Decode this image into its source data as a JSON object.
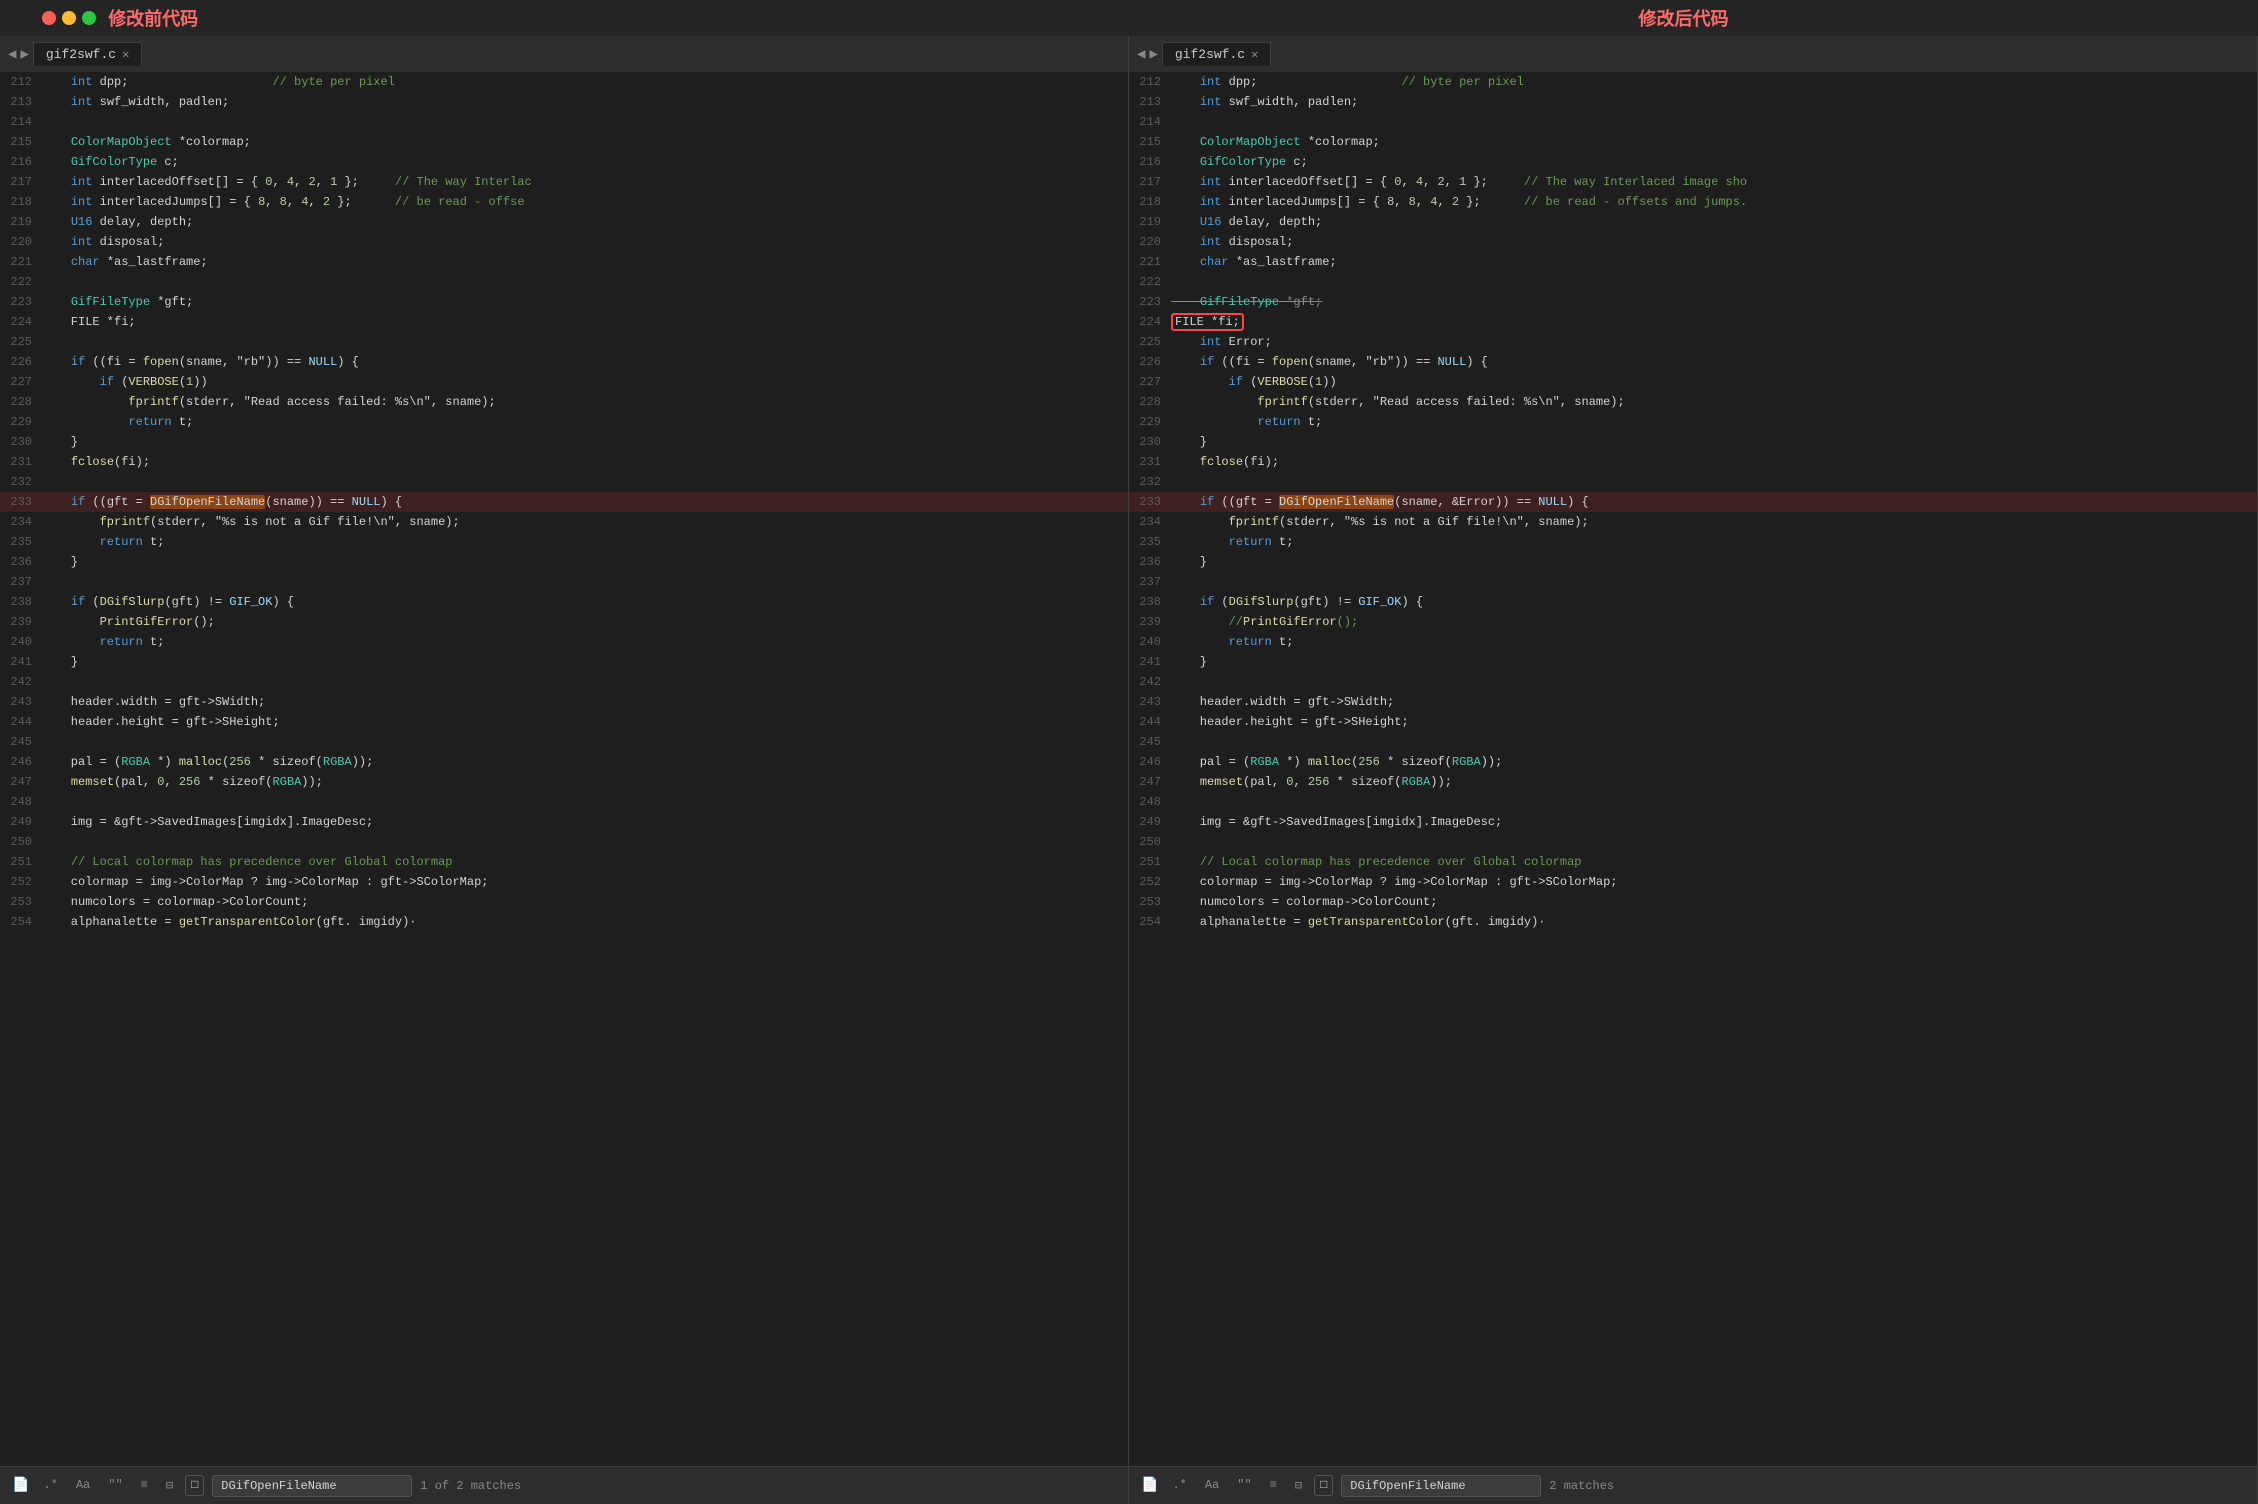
{
  "titles": {
    "left": "修改前代码",
    "right": "修改后代码"
  },
  "tabs": {
    "filename": "gif2swf.c"
  },
  "search": {
    "left": {
      "label": ".*",
      "label2": "Aa",
      "label3": "\"\"",
      "label4": "≡",
      "label5": "⊟",
      "label6": "□",
      "query": "DGifOpenFileName",
      "matches": "1 of 2 matches"
    },
    "right": {
      "label": ".*",
      "label2": "Aa",
      "label3": "\"\"",
      "label4": "≡",
      "label5": "⊟",
      "label6": "□",
      "query": "DGifOpenFileName",
      "matches": "2 matches"
    }
  },
  "left_lines": [
    {
      "num": "212",
      "raw": "    int dpp;                    // byte per pixel"
    },
    {
      "num": "213",
      "raw": "    int swf_width, padlen;"
    },
    {
      "num": "214",
      "raw": ""
    },
    {
      "num": "215",
      "raw": "    ColorMapObject *colormap;"
    },
    {
      "num": "216",
      "raw": "    GifColorType c;"
    },
    {
      "num": "217",
      "raw": "    int interlacedOffset[] = { 0, 4, 2, 1 };     // The way Interlac"
    },
    {
      "num": "218",
      "raw": "    int interlacedJumps[] = { 8, 8, 4, 2 };      // be read - offse"
    },
    {
      "num": "219",
      "raw": "    U16 delay, depth;"
    },
    {
      "num": "220",
      "raw": "    int disposal;"
    },
    {
      "num": "221",
      "raw": "    char *as_lastframe;"
    },
    {
      "num": "222",
      "raw": ""
    },
    {
      "num": "223",
      "raw": "    GifFileType *gft;"
    },
    {
      "num": "224",
      "raw": "    FILE *fi;"
    },
    {
      "num": "225",
      "raw": ""
    },
    {
      "num": "226",
      "raw": "    if ((fi = fopen(sname, \"rb\")) == NULL) {"
    },
    {
      "num": "227",
      "raw": "        if (VERBOSE(1))"
    },
    {
      "num": "228",
      "raw": "            fprintf(stderr, \"Read access failed: %s\\n\", sname);"
    },
    {
      "num": "229",
      "raw": "            return t;"
    },
    {
      "num": "230",
      "raw": "    }"
    },
    {
      "num": "231",
      "raw": "    fclose(fi);"
    },
    {
      "num": "232",
      "raw": ""
    },
    {
      "num": "233",
      "raw": "    if ((gft = DGifOpenFileName(sname)) == NULL) {",
      "highlight": true
    },
    {
      "num": "234",
      "raw": "        fprintf(stderr, \"%s is not a Gif file!\\n\", sname);"
    },
    {
      "num": "235",
      "raw": "        return t;"
    },
    {
      "num": "236",
      "raw": "    }"
    },
    {
      "num": "237",
      "raw": ""
    },
    {
      "num": "238",
      "raw": "    if (DGifSlurp(gft) != GIF_OK) {"
    },
    {
      "num": "239",
      "raw": "        PrintGifError();"
    },
    {
      "num": "240",
      "raw": "        return t;"
    },
    {
      "num": "241",
      "raw": "    }"
    },
    {
      "num": "242",
      "raw": ""
    },
    {
      "num": "243",
      "raw": "    header.width = gft->SWidth;"
    },
    {
      "num": "244",
      "raw": "    header.height = gft->SHeight;"
    },
    {
      "num": "245",
      "raw": ""
    },
    {
      "num": "246",
      "raw": "    pal = (RGBA *) malloc(256 * sizeof(RGBA));"
    },
    {
      "num": "247",
      "raw": "    memset(pal, 0, 256 * sizeof(RGBA));"
    },
    {
      "num": "248",
      "raw": ""
    },
    {
      "num": "249",
      "raw": "    img = &gft->SavedImages[imgidx].ImageDesc;"
    },
    {
      "num": "250",
      "raw": ""
    },
    {
      "num": "251",
      "raw": "    // Local colormap has precedence over Global colormap"
    },
    {
      "num": "252",
      "raw": "    colormap = img->ColorMap ? img->ColorMap : gft->SColorMap;"
    },
    {
      "num": "253",
      "raw": "    numcolors = colormap->ColorCount;"
    },
    {
      "num": "254",
      "raw": "    alphanalette = getTransparentColor(gft. imgidy)·"
    }
  ],
  "right_lines": [
    {
      "num": "212",
      "raw": "    int dpp;                    // byte per pixel"
    },
    {
      "num": "213",
      "raw": "    int swf_width, padlen;"
    },
    {
      "num": "214",
      "raw": ""
    },
    {
      "num": "215",
      "raw": "    ColorMapObject *colormap;"
    },
    {
      "num": "216",
      "raw": "    GifColorType c;"
    },
    {
      "num": "217",
      "raw": "    int interlacedOffset[] = { 0, 4, 2, 1 };     // The way Interlaced image sho"
    },
    {
      "num": "218",
      "raw": "    int interlacedJumps[] = { 8, 8, 4, 2 };      // be read - offsets and jumps."
    },
    {
      "num": "219",
      "raw": "    U16 delay, depth;"
    },
    {
      "num": "220",
      "raw": "    int disposal;"
    },
    {
      "num": "221",
      "raw": "    char *as_lastframe;"
    },
    {
      "num": "222",
      "raw": ""
    },
    {
      "num": "223",
      "raw": "    GifFileType *gft;",
      "strikethrough": true
    },
    {
      "num": "224",
      "raw": "    FILE *fi;",
      "redbox": true
    },
    {
      "num": "225",
      "raw": "    int Error;"
    },
    {
      "num": "226",
      "raw": "    if ((fi = fopen(sname, \"rb\")) == NULL) {"
    },
    {
      "num": "227",
      "raw": "        if (VERBOSE(1))"
    },
    {
      "num": "228",
      "raw": "            fprintf(stderr, \"Read access failed: %s\\n\", sname);"
    },
    {
      "num": "229",
      "raw": "            return t;"
    },
    {
      "num": "230",
      "raw": "    }"
    },
    {
      "num": "231",
      "raw": "    fclose(fi);"
    },
    {
      "num": "232",
      "raw": ""
    },
    {
      "num": "233",
      "raw": "    if ((gft = DGifOpenFileName(sname, &Error)) == NULL) {",
      "highlight": true
    },
    {
      "num": "234",
      "raw": "        fprintf(stderr, \"%s is not a Gif file!\\n\", sname);"
    },
    {
      "num": "235",
      "raw": "        return t;"
    },
    {
      "num": "236",
      "raw": "    }"
    },
    {
      "num": "237",
      "raw": ""
    },
    {
      "num": "238",
      "raw": "    if (DGifSlurp(gft) != GIF_OK) {"
    },
    {
      "num": "239",
      "raw": "        //PrintGifError();"
    },
    {
      "num": "240",
      "raw": "        return t;"
    },
    {
      "num": "241",
      "raw": "    }"
    },
    {
      "num": "242",
      "raw": ""
    },
    {
      "num": "243",
      "raw": "    header.width = gft->SWidth;"
    },
    {
      "num": "244",
      "raw": "    header.height = gft->SHeight;"
    },
    {
      "num": "245",
      "raw": ""
    },
    {
      "num": "246",
      "raw": "    pal = (RGBA *) malloc(256 * sizeof(RGBA));"
    },
    {
      "num": "247",
      "raw": "    memset(pal, 0, 256 * sizeof(RGBA));"
    },
    {
      "num": "248",
      "raw": ""
    },
    {
      "num": "249",
      "raw": "    img = &gft->SavedImages[imgidx].ImageDesc;"
    },
    {
      "num": "250",
      "raw": ""
    },
    {
      "num": "251",
      "raw": "    // Local colormap has precedence over Global colormap"
    },
    {
      "num": "252",
      "raw": "    colormap = img->ColorMap ? img->ColorMap : gft->SColorMap;"
    },
    {
      "num": "253",
      "raw": "    numcolors = colormap->ColorCount;"
    },
    {
      "num": "254",
      "raw": "    alphanalette = getTransparentColor(gft. imgidy)·"
    }
  ]
}
